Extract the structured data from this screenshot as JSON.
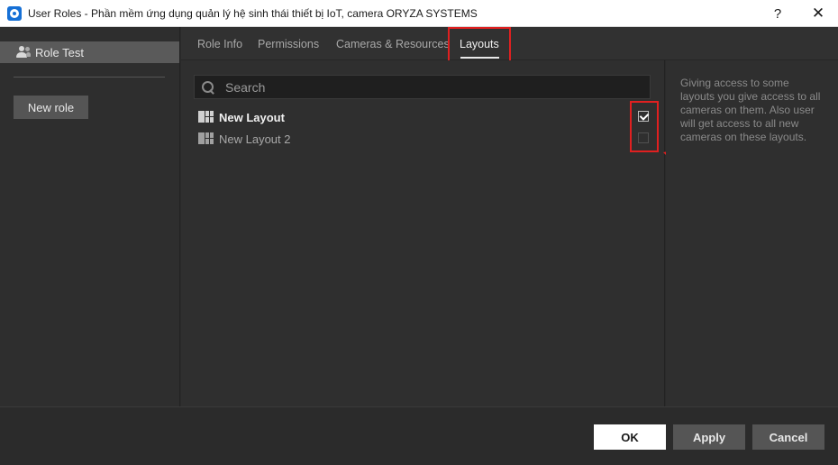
{
  "window": {
    "title": "User Roles - Phần mềm ứng dụng quản lý hệ sinh thái thiết bị IoT, camera ORYZA SYSTEMS",
    "help_label": "?",
    "close_label": "✕"
  },
  "sidebar": {
    "roles": [
      {
        "label": "Role Test",
        "selected": true
      }
    ],
    "new_role_label": "New role"
  },
  "tabs": [
    {
      "label": "Role Info",
      "active": false
    },
    {
      "label": "Permissions",
      "active": false
    },
    {
      "label": "Cameras & Resources",
      "active": false
    },
    {
      "label": "Layouts",
      "active": true
    }
  ],
  "search": {
    "placeholder": "Search",
    "value": ""
  },
  "layouts": [
    {
      "name": "New Layout",
      "checked": true
    },
    {
      "name": "New Layout 2",
      "checked": false
    }
  ],
  "info": {
    "text": "Giving access to some layouts you give access to all cameras on them. Also user will get access to all new cameras on these layouts."
  },
  "footer": {
    "ok_label": "OK",
    "apply_label": "Apply",
    "cancel_label": "Cancel"
  },
  "colors": {
    "annotation": "#e02020",
    "background": "#2b2b2b",
    "panel": "#2f2f2f",
    "button": "#555555"
  }
}
